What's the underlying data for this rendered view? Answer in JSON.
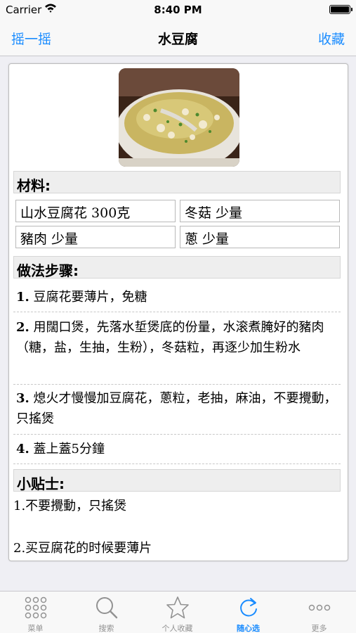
{
  "status_bar": {
    "carrier": "Carrier",
    "time": "8:40 PM"
  },
  "nav": {
    "left_button": "摇一摇",
    "title": "水豆腐",
    "right_button": "收藏"
  },
  "recipe": {
    "image_alt": "水豆腐",
    "ingredients_header": "材料:",
    "ingredients": [
      "山水豆腐花 300克",
      "冬菇 少量",
      "豬肉 少量",
      "蔥 少量"
    ],
    "steps_header": "做法步骤:",
    "steps": [
      {
        "num": "1.",
        "text": "豆腐花要薄片，免糖"
      },
      {
        "num": "2.",
        "text": "用闊口煲，先落水埑煲底的份量，水滚煮腌好的豬肉（糖，盐，生抽，生粉），冬菇粒，再逐少加生粉水"
      },
      {
        "num": "3.",
        "text": "熄火才慢慢加豆腐花，蔥粒，老抽，麻油，不要攪動，只搖煲"
      },
      {
        "num": "4.",
        "text": "蓋上蓋5分鐘"
      }
    ],
    "tips_header": "小贴士:",
    "tips": [
      "1.不要攪動，只搖煲",
      "2.买豆腐花的时候要薄片"
    ]
  },
  "tabs": [
    {
      "label": "菜单",
      "icon": "grid-icon",
      "active": false
    },
    {
      "label": "搜索",
      "icon": "search-icon",
      "active": false
    },
    {
      "label": "个人收藏",
      "icon": "star-icon",
      "active": false
    },
    {
      "label": "随心选",
      "icon": "refresh-icon",
      "active": true
    },
    {
      "label": "更多",
      "icon": "more-icon",
      "active": false
    }
  ],
  "colors": {
    "accent": "#1a8cff",
    "inactive": "#929292",
    "header_bg": "#eeeeee"
  }
}
